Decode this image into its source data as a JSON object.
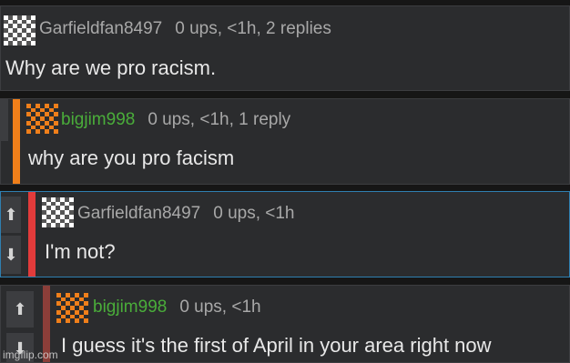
{
  "comments": [
    {
      "username": "Garfieldfan8497",
      "stats": "0 ups, <1h, 2 replies",
      "text": "Why are we pro racism."
    },
    {
      "username": "bigjim998",
      "stats": "0 ups, <1h, 1 reply",
      "text": "why are you pro facism"
    },
    {
      "username": "Garfieldfan8497",
      "stats": "0 ups, <1h",
      "text": "I'm not?"
    },
    {
      "username": "bigjim998",
      "stats": "0 ups, <1h",
      "text": "I guess it's the first of April in your area right now"
    }
  ],
  "icons": {
    "upvote": "arrow-up-icon",
    "downvote": "arrow-down-icon"
  },
  "vote_glyphs": {
    "up": "⬆",
    "down": "⬇"
  },
  "colors": {
    "orange": "#f07f1a",
    "red": "#e23b3b",
    "green_username": "#4aad3a",
    "highlight_border": "#2f7fb0"
  },
  "watermark": "imgflip.com"
}
